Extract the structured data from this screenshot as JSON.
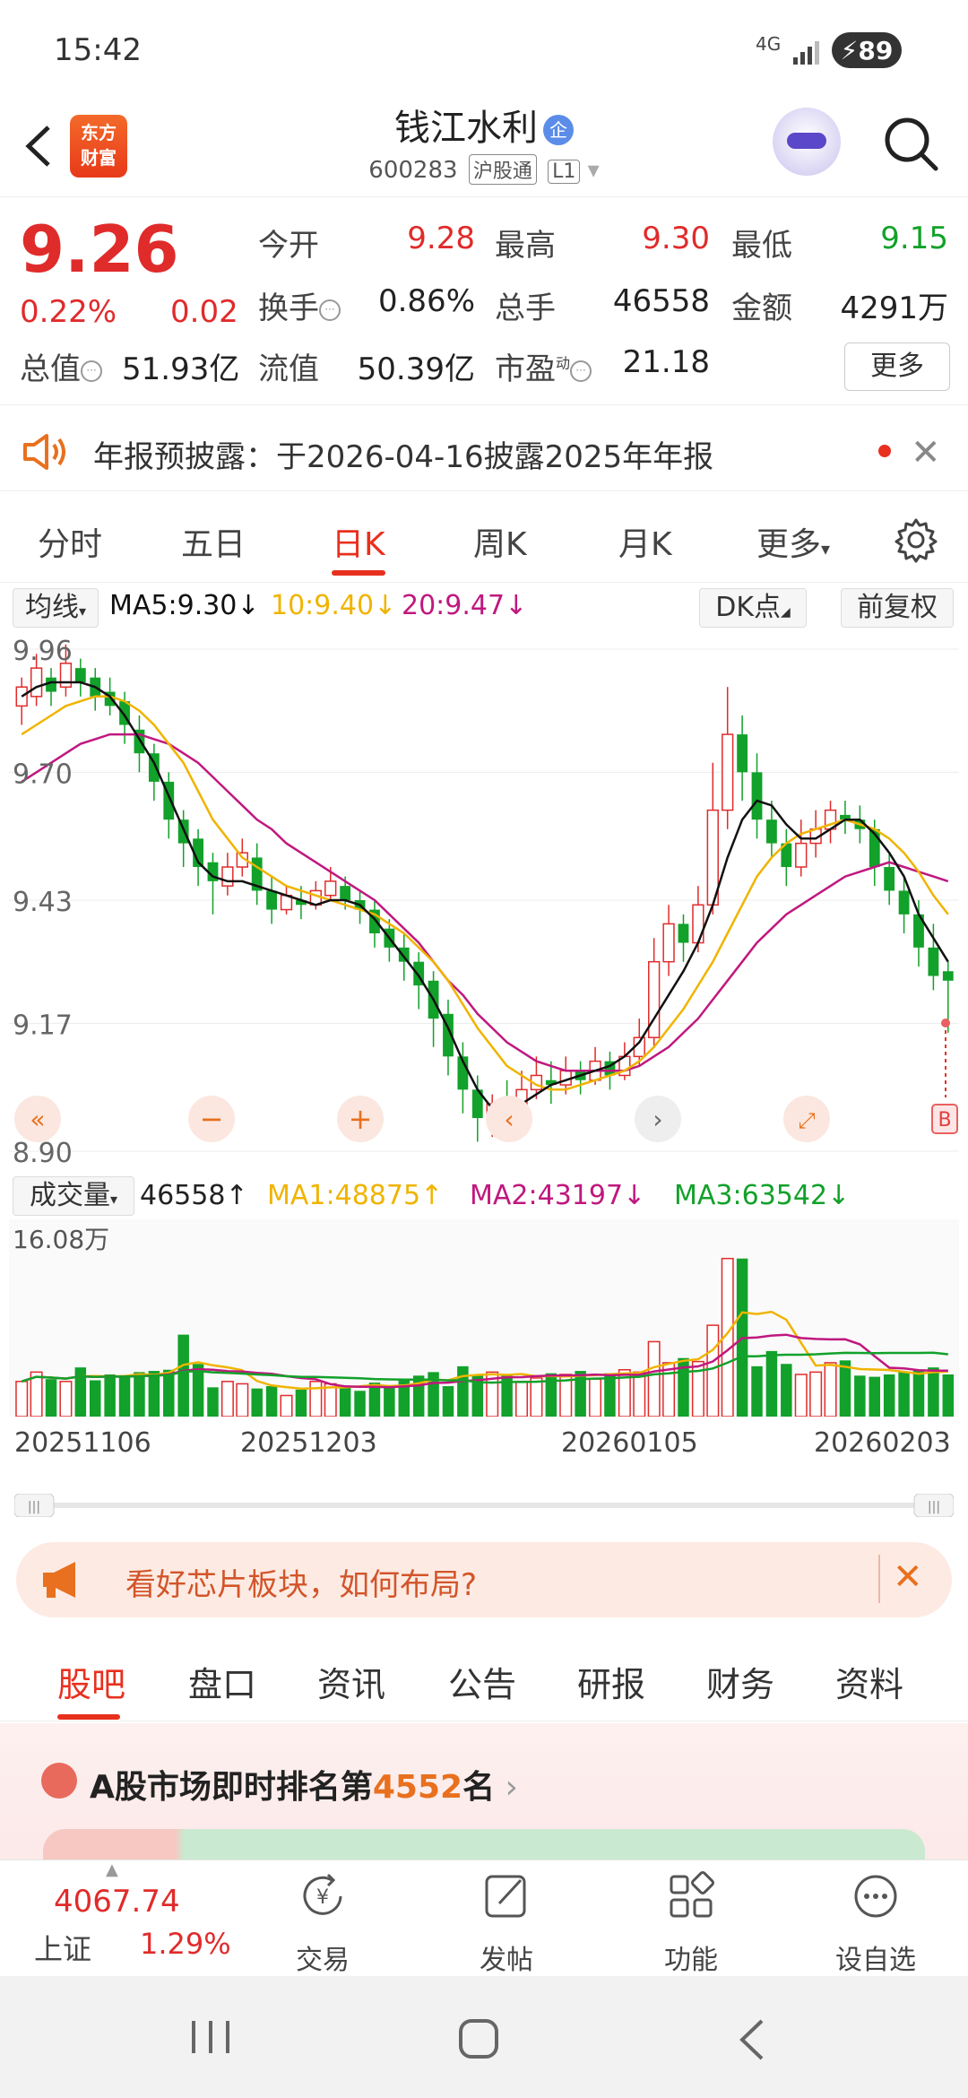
{
  "status": {
    "time": "15:42",
    "network": "4G",
    "battery": "89"
  },
  "header": {
    "logo_text_1": "东方",
    "logo_text_2": "财富",
    "stock_name": "钱江水利",
    "badge": "企",
    "stock_code": "600283",
    "tag_hsgt": "沪股通",
    "tag_level": "L1"
  },
  "quote": {
    "price": "9.26",
    "change_pct": "0.22%",
    "change": "0.02",
    "open_label": "今开",
    "open": "9.28",
    "high_label": "最高",
    "high": "9.30",
    "low_label": "最低",
    "low": "9.15",
    "turnover_label": "换手",
    "turnover": "0.86%",
    "volume_label": "总手",
    "volume": "46558",
    "amount_label": "金额",
    "amount": "4291万",
    "total_mv_label": "总值",
    "total_mv": "51.93亿",
    "float_mv_label": "流值",
    "float_mv": "50.39亿",
    "pe_label": "市盈",
    "pe_sup": "动",
    "pe": "21.18",
    "more_button": "更多"
  },
  "notice": {
    "text": "年报预披露：于2026-04-16披露2025年年报"
  },
  "kline_tabs": [
    "分时",
    "五日",
    "日K",
    "周K",
    "月K",
    "更多"
  ],
  "kline_tab_active": 2,
  "ma_bar": {
    "ma_select": "均线",
    "ma5": "MA5:9.30",
    "ma10": "10:9.40",
    "ma20": "20:9.47",
    "dk_button": "DK点",
    "adjust_button": "前复权"
  },
  "colors": {
    "up": "#e02b2b",
    "down": "#12a12a",
    "ma5": "#111111",
    "ma10": "#f0b400",
    "ma20": "#c0187f",
    "accent": "#e8301e"
  },
  "chart_data": {
    "type": "candlestick",
    "y_ticks": [
      "9.96",
      "9.70",
      "9.43",
      "9.17",
      "8.90"
    ],
    "ylim": [
      8.9,
      9.96
    ],
    "x_tick_labels": [
      "20251106",
      "20251203",
      "20260105",
      "20260203"
    ],
    "candles": [
      [
        9.84,
        9.88,
        9.8,
        9.9
      ],
      [
        9.86,
        9.92,
        9.84,
        9.95
      ],
      [
        9.9,
        9.87,
        9.84,
        9.92
      ],
      [
        9.88,
        9.93,
        9.86,
        9.97
      ],
      [
        9.92,
        9.89,
        9.86,
        9.94
      ],
      [
        9.9,
        9.86,
        9.83,
        9.92
      ],
      [
        9.87,
        9.84,
        9.82,
        9.9
      ],
      [
        9.85,
        9.8,
        9.76,
        9.87
      ],
      [
        9.79,
        9.74,
        9.7,
        9.82
      ],
      [
        9.74,
        9.68,
        9.64,
        9.76
      ],
      [
        9.68,
        9.6,
        9.56,
        9.7
      ],
      [
        9.6,
        9.55,
        9.5,
        9.62
      ],
      [
        9.56,
        9.5,
        9.46,
        9.58
      ],
      [
        9.51,
        9.47,
        9.4,
        9.53
      ],
      [
        9.46,
        9.5,
        9.44,
        9.53
      ],
      [
        9.5,
        9.53,
        9.48,
        9.56
      ],
      [
        9.52,
        9.45,
        9.42,
        9.55
      ],
      [
        9.45,
        9.41,
        9.38,
        9.48
      ],
      [
        9.41,
        9.44,
        9.4,
        9.46
      ],
      [
        9.43,
        9.42,
        9.39,
        9.46
      ],
      [
        9.42,
        9.45,
        9.41,
        9.47
      ],
      [
        9.44,
        9.47,
        9.43,
        9.5
      ],
      [
        9.46,
        9.43,
        9.41,
        9.48
      ],
      [
        9.43,
        9.41,
        9.38,
        9.45
      ],
      [
        9.41,
        9.36,
        9.33,
        9.43
      ],
      [
        9.37,
        9.33,
        9.3,
        9.39
      ],
      [
        9.33,
        9.3,
        9.26,
        9.36
      ],
      [
        9.3,
        9.25,
        9.2,
        9.32
      ],
      [
        9.26,
        9.18,
        9.12,
        9.28
      ],
      [
        9.19,
        9.1,
        9.06,
        9.22
      ],
      [
        9.1,
        9.03,
        8.98,
        9.13
      ],
      [
        9.03,
        8.97,
        8.92,
        9.06
      ],
      [
        8.97,
        9.0,
        8.93,
        9.02
      ],
      [
        9.0,
        8.99,
        8.95,
        9.05
      ],
      [
        8.99,
        9.03,
        8.98,
        9.07
      ],
      [
        9.03,
        9.06,
        9.01,
        9.1
      ],
      [
        9.05,
        9.04,
        9.0,
        9.09
      ],
      [
        9.04,
        9.07,
        9.02,
        9.1
      ],
      [
        9.07,
        9.05,
        9.02,
        9.09
      ],
      [
        9.05,
        9.09,
        9.04,
        9.12
      ],
      [
        9.09,
        9.06,
        9.03,
        9.11
      ],
      [
        9.06,
        9.1,
        9.05,
        9.13
      ],
      [
        9.1,
        9.14,
        9.08,
        9.18
      ],
      [
        9.14,
        9.3,
        9.12,
        9.35
      ],
      [
        9.3,
        9.38,
        9.27,
        9.42
      ],
      [
        9.38,
        9.34,
        9.3,
        9.4
      ],
      [
        9.34,
        9.42,
        9.32,
        9.46
      ],
      [
        9.42,
        9.62,
        9.4,
        9.72
      ],
      [
        9.62,
        9.78,
        9.58,
        9.88
      ],
      [
        9.78,
        9.7,
        9.64,
        9.82
      ],
      [
        9.7,
        9.6,
        9.56,
        9.74
      ],
      [
        9.6,
        9.55,
        9.52,
        9.64
      ],
      [
        9.55,
        9.5,
        9.46,
        9.58
      ],
      [
        9.5,
        9.55,
        9.48,
        9.6
      ],
      [
        9.55,
        9.58,
        9.52,
        9.62
      ],
      [
        9.58,
        9.62,
        9.55,
        9.64
      ],
      [
        9.61,
        9.6,
        9.57,
        9.64
      ],
      [
        9.6,
        9.58,
        9.55,
        9.63
      ],
      [
        9.58,
        9.5,
        9.46,
        9.6
      ],
      [
        9.5,
        9.45,
        9.42,
        9.53
      ],
      [
        9.45,
        9.4,
        9.36,
        9.48
      ],
      [
        9.4,
        9.33,
        9.29,
        9.43
      ],
      [
        9.33,
        9.27,
        9.24,
        9.38
      ],
      [
        9.28,
        9.26,
        9.15,
        9.3
      ]
    ],
    "ma5": [
      9.86,
      9.88,
      9.89,
      9.89,
      9.89,
      9.88,
      9.86,
      9.82,
      9.77,
      9.72,
      9.65,
      9.58,
      9.51,
      9.48,
      9.47,
      9.47,
      9.46,
      9.45,
      9.44,
      9.43,
      9.42,
      9.43,
      9.43,
      9.42,
      9.39,
      9.35,
      9.31,
      9.27,
      9.22,
      9.16,
      9.09,
      9.03,
      8.99,
      8.99,
      9.0,
      9.02,
      9.04,
      9.05,
      9.06,
      9.07,
      9.08,
      9.1,
      9.13,
      9.18,
      9.23,
      9.28,
      9.34,
      9.42,
      9.52,
      9.6,
      9.64,
      9.63,
      9.59,
      9.56,
      9.56,
      9.58,
      9.6,
      9.6,
      9.57,
      9.53,
      9.48,
      9.4,
      9.35,
      9.3
    ],
    "ma10": [
      9.78,
      9.8,
      9.82,
      9.84,
      9.85,
      9.86,
      9.86,
      9.85,
      9.83,
      9.8,
      9.76,
      9.72,
      9.66,
      9.6,
      9.56,
      9.52,
      9.5,
      9.48,
      9.46,
      9.45,
      9.44,
      9.43,
      9.42,
      9.41,
      9.4,
      9.38,
      9.36,
      9.33,
      9.3,
      9.26,
      9.21,
      9.16,
      9.12,
      9.08,
      9.06,
      9.04,
      9.03,
      9.03,
      9.04,
      9.05,
      9.06,
      9.07,
      9.09,
      9.12,
      9.16,
      9.2,
      9.25,
      9.3,
      9.36,
      9.42,
      9.48,
      9.52,
      9.55,
      9.57,
      9.58,
      9.59,
      9.6,
      9.59,
      9.58,
      9.56,
      9.53,
      9.49,
      9.44,
      9.4
    ],
    "ma20": [
      9.68,
      9.7,
      9.72,
      9.74,
      9.76,
      9.77,
      9.78,
      9.78,
      9.78,
      9.77,
      9.76,
      9.74,
      9.72,
      9.69,
      9.66,
      9.63,
      9.6,
      9.58,
      9.55,
      9.53,
      9.51,
      9.49,
      9.47,
      9.45,
      9.43,
      9.4,
      9.37,
      9.34,
      9.3,
      9.26,
      9.23,
      9.19,
      9.16,
      9.13,
      9.11,
      9.09,
      9.08,
      9.07,
      9.07,
      9.07,
      9.07,
      9.07,
      9.08,
      9.1,
      9.12,
      9.15,
      9.18,
      9.22,
      9.26,
      9.3,
      9.34,
      9.37,
      9.4,
      9.42,
      9.44,
      9.46,
      9.48,
      9.49,
      9.5,
      9.51,
      9.5,
      9.49,
      9.48,
      9.47
    ]
  },
  "volume": {
    "select": "成交量",
    "value": "46558",
    "ma1": "MA1:48875",
    "ma2": "MA2:43197",
    "ma3": "MA3:63542",
    "max_label": "16.08万",
    "bars": [
      3.0,
      3.8,
      3.2,
      3.0,
      4.2,
      3.1,
      3.6,
      3.4,
      3.8,
      3.9,
      4.0,
      7.0,
      4.5,
      2.5,
      3.0,
      2.8,
      2.4,
      2.6,
      1.8,
      2.3,
      3.0,
      2.8,
      2.6,
      2.2,
      2.9,
      2.5,
      3.1,
      3.5,
      3.8,
      2.6,
      4.3,
      3.6,
      3.8,
      3.5,
      3.0,
      3.3,
      3.7,
      3.6,
      3.9,
      3.2,
      3.7,
      4.0,
      3.8,
      6.4,
      4.6,
      5.0,
      4.7,
      7.8,
      13.5,
      13.5,
      4.3,
      5.6,
      4.5,
      3.6,
      3.8,
      4.6,
      4.8,
      3.5,
      3.4,
      3.6,
      3.8,
      4.0,
      4.2,
      3.6
    ]
  },
  "dates": [
    "20251106",
    "20251203",
    "20260105",
    "20260203"
  ],
  "promo": {
    "text": "看好芯片板块，如何布局?"
  },
  "section_tabs": [
    "股吧",
    "盘口",
    "资讯",
    "公告",
    "研报",
    "财务",
    "资料"
  ],
  "rank": {
    "prefix": "A股市场即时排名第",
    "number": "4552",
    "suffix": "名"
  },
  "bottom": {
    "index_value": "4067.74",
    "index_name": "上证",
    "index_pct": "1.29%",
    "nav": [
      "交易",
      "发帖",
      "功能",
      "设自选"
    ]
  }
}
